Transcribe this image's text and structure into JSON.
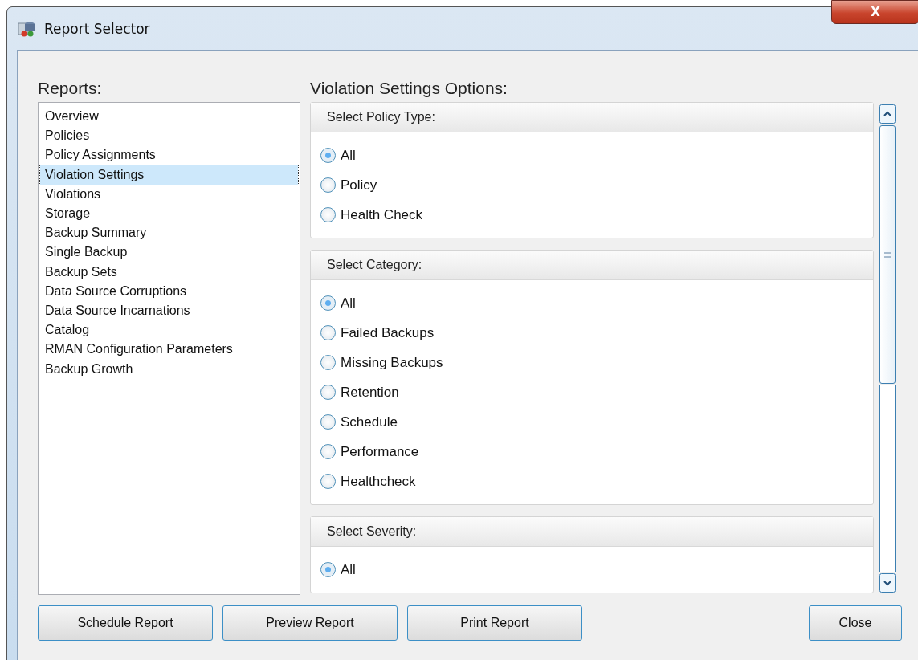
{
  "window": {
    "title": "Report Selector",
    "close_label": "X"
  },
  "reports": {
    "label": "Reports:",
    "items": [
      {
        "label": "Overview",
        "selected": false
      },
      {
        "label": "Policies",
        "selected": false
      },
      {
        "label": "Policy Assignments",
        "selected": false
      },
      {
        "label": "Violation Settings",
        "selected": true
      },
      {
        "label": "Violations",
        "selected": false
      },
      {
        "label": "Storage",
        "selected": false
      },
      {
        "label": "Backup Summary",
        "selected": false
      },
      {
        "label": "Single Backup",
        "selected": false
      },
      {
        "label": "Backup Sets",
        "selected": false
      },
      {
        "label": "Data Source Corruptions",
        "selected": false
      },
      {
        "label": "Data Source Incarnations",
        "selected": false
      },
      {
        "label": "Catalog",
        "selected": false
      },
      {
        "label": "RMAN Configuration Parameters",
        "selected": false
      },
      {
        "label": "Backup Growth",
        "selected": false
      }
    ]
  },
  "options": {
    "title": "Violation Settings Options:",
    "groups": [
      {
        "title": "Select Policy Type:",
        "options": [
          {
            "label": "All",
            "selected": true
          },
          {
            "label": "Policy",
            "selected": false
          },
          {
            "label": "Health Check",
            "selected": false
          }
        ]
      },
      {
        "title": "Select Category:",
        "options": [
          {
            "label": "All",
            "selected": true
          },
          {
            "label": "Failed Backups",
            "selected": false
          },
          {
            "label": "Missing Backups",
            "selected": false
          },
          {
            "label": "Retention",
            "selected": false
          },
          {
            "label": "Schedule",
            "selected": false
          },
          {
            "label": "Performance",
            "selected": false
          },
          {
            "label": "Healthcheck",
            "selected": false
          }
        ]
      },
      {
        "title": "Select Severity:",
        "options": [
          {
            "label": "All",
            "selected": true
          }
        ]
      }
    ]
  },
  "buttons": [
    "Schedule Report",
    "Preview Report",
    "Print Report"
  ],
  "close_button": "Close"
}
